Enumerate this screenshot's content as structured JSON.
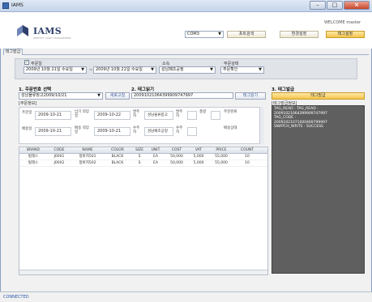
{
  "window": {
    "title": "IAMS",
    "buttons": [
      "–",
      "□",
      "×"
    ]
  },
  "header": {
    "logo": "IAMS",
    "logo_sub": "IDENTITY ASSET MANAGEMENT",
    "welcome": "WELCOME master",
    "port_select": "COM3",
    "port_search": "포트검색",
    "env_settings": "환경설정",
    "tag_env": "태그설정"
  },
  "tab": {
    "label": "태그발급"
  },
  "filter": {
    "order_date_label": "주문일",
    "date_from": "2009년 10월 21일 수요일",
    "date_sep": "~",
    "date_to": "2009년 10월 21일 수요일",
    "affiliation_label": "소속",
    "affiliation_value": "성남패조공정",
    "order_status_label": "주문상태",
    "order_status_value": "주문확인"
  },
  "section1": {
    "title": "1. 주문번호 선택",
    "order_select": "성남물류창고2009/10/21",
    "refresh": "새로고침",
    "detail_label": "[주문정보]"
  },
  "section2": {
    "title": "2. 태그읽기",
    "tag_value": "20091021064399909747997",
    "read_button": "태그읽기"
  },
  "section3": {
    "title": "3. 태그발급",
    "issue_button": "태그발급",
    "info_label": "[태그발급정보]"
  },
  "order_form": {
    "order_date_label": "주문일",
    "order_date": "2009-10-21",
    "delivery_date_label": "납기 희망일",
    "delivery_date": "2009-10-22",
    "orderer_label": "발주자",
    "orderer": "성남물류창고",
    "issuer_label": "발주자",
    "qty_label": "총량",
    "order_chk_label": "주문완료",
    "ship_date_label": "배송일",
    "ship_date": "2009-10-21",
    "ship_hope_label": "배송 희망일",
    "ship_hope": "2009-10-21",
    "receiver_label": "수주자",
    "receiver": "성남패조공정",
    "rcv_label": "수주자",
    "ship_done_label": "배송상태"
  },
  "grid": {
    "columns": [
      "BRAND",
      "CODE",
      "NAME",
      "COLOR",
      "SIZE",
      "UNIT",
      "COST",
      "VAT",
      "PRICE",
      "COUNT"
    ],
    "rows": [
      [
        "빌레스",
        "J0001",
        "청바지501",
        "BLACK",
        "S",
        "EA",
        "50,000",
        "5,000",
        "55,000",
        "10"
      ],
      [
        "빌레스",
        "J0002",
        "청바지502",
        "BLACK",
        "S",
        "EA",
        "50,000",
        "5,000",
        "55,000",
        "10"
      ]
    ]
  },
  "log": {
    "lines": [
      "TAG_READ :      TAG_READ :",
      "          20091021064399909747997",
      "TAG_CODE :",
      "          20091021071000469799997",
      "SWATCH_WRITE :          SUCCESS"
    ]
  },
  "status": {
    "text": "CONNECTED"
  },
  "colors": {
    "accent": "#f4c54b",
    "log_bg": "#5f5f5f",
    "status": "#2e5aa8"
  }
}
